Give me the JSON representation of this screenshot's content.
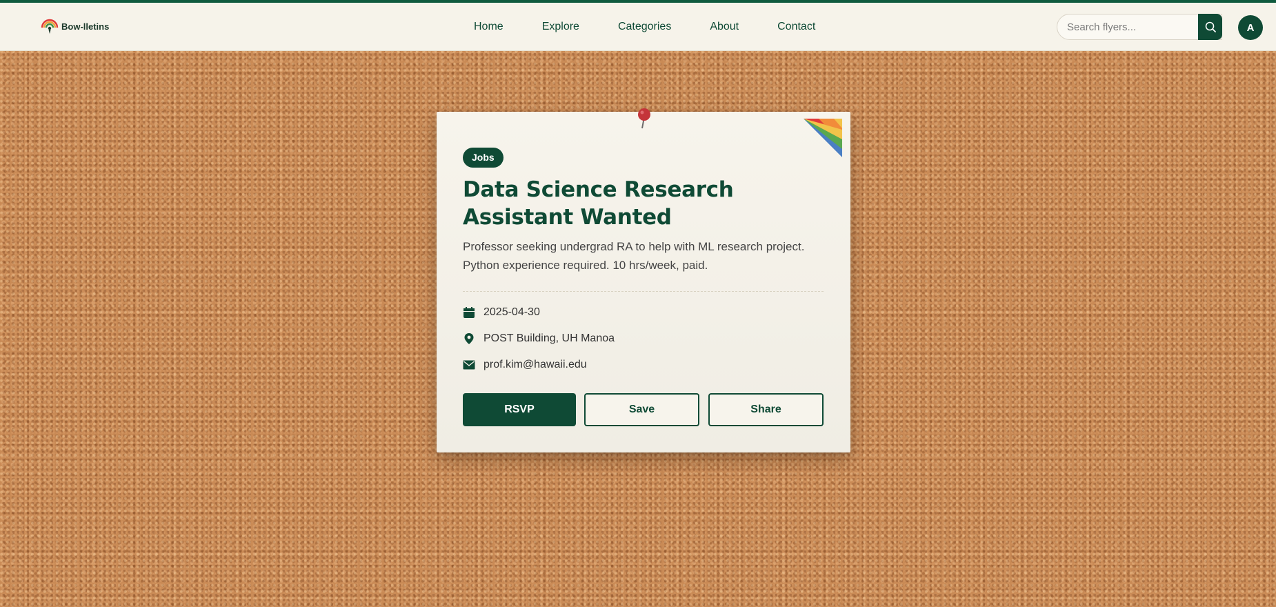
{
  "header": {
    "brand": "Bow-lletins",
    "nav": [
      {
        "label": "Home"
      },
      {
        "label": "Explore"
      },
      {
        "label": "Categories"
      },
      {
        "label": "About"
      },
      {
        "label": "Contact"
      }
    ],
    "search": {
      "placeholder": "Search flyers...",
      "value": ""
    },
    "avatar_initial": "A"
  },
  "flyer": {
    "category": "Jobs",
    "title": "Data Science Research Assistant Wanted",
    "description": "Professor seeking undergrad RA to help with ML research project. Python experience required. 10 hrs/week, paid.",
    "details": {
      "date": "2025-04-30",
      "location": "POST Building, UH Manoa",
      "contact": "prof.kim@hawaii.edu"
    },
    "actions": {
      "rsvp": "RSVP",
      "save": "Save",
      "share": "Share"
    }
  },
  "colors": {
    "brand_green": "#0f4a35",
    "paper": "#f7f4ec",
    "cork": "#c98a55",
    "pin_red": "#c4343a"
  },
  "icons": {
    "date": "calendar-icon",
    "location": "map-pin-icon",
    "contact": "envelope-icon",
    "search": "search-icon"
  }
}
